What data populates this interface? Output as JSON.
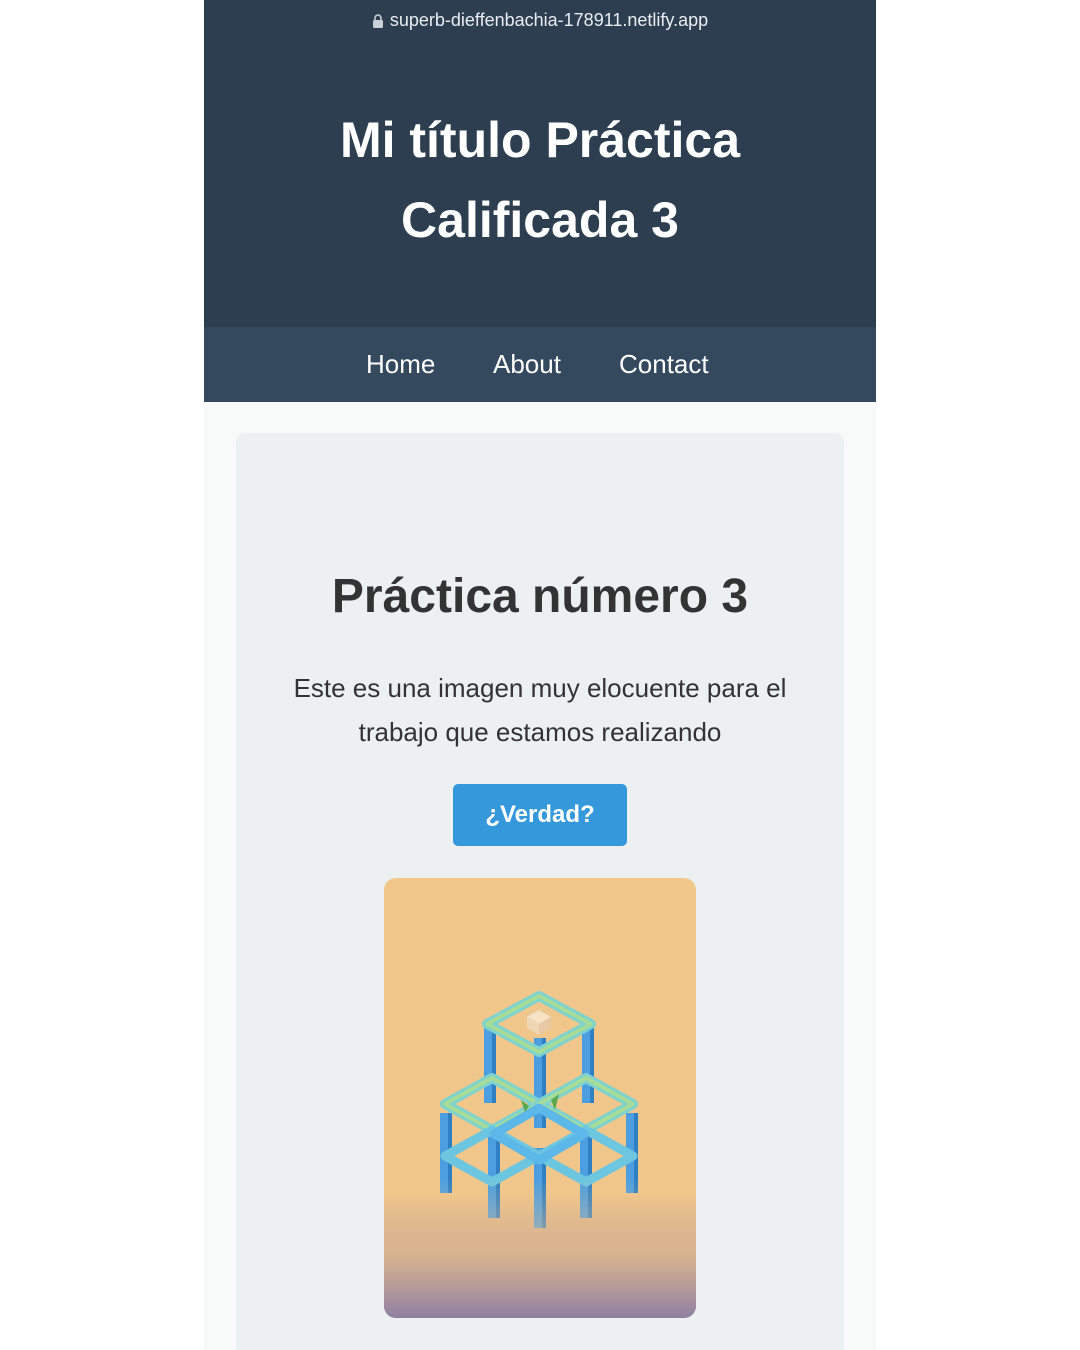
{
  "browser": {
    "url": "superb-dieffenbachia-178911.netlify.app"
  },
  "header": {
    "title": "Mi título Práctica Calificada 3"
  },
  "nav": {
    "items": [
      {
        "label": "Home"
      },
      {
        "label": "About"
      },
      {
        "label": "Contact"
      }
    ]
  },
  "main": {
    "heading": "Práctica número 3",
    "description": "Este es una imagen muy elocuente para el trabajo que estamos realizando",
    "button_label": "¿Verdad?",
    "image": {
      "subject": "isometric impossible cube structure"
    }
  },
  "colors": {
    "header_bg": "#2d3e50",
    "nav_bg": "#34495e",
    "card_bg": "#ecf0f1",
    "button_bg": "#3498db",
    "image_bg_top": "#f0c68a",
    "image_bg_bottom": "#8e80a2"
  },
  "icons": {
    "url_lock": "lock-icon"
  }
}
